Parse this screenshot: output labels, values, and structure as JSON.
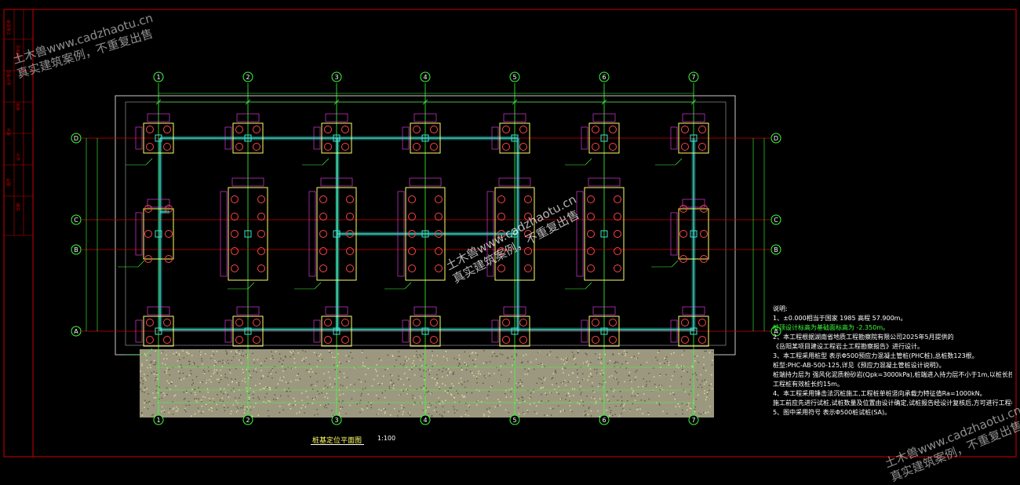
{
  "grid": {
    "columns": [
      "1",
      "2",
      "3",
      "4",
      "5",
      "6",
      "7"
    ],
    "rows": [
      "D",
      "C",
      "B",
      "A"
    ]
  },
  "plan": {
    "title": "桩基定位平面图",
    "scale": "1:100"
  },
  "notes": {
    "heading": "说明:",
    "lines": [
      "1、±0.000相当于国家 1985 高程 57.900m。",
      "桩顶设计标高为基础面标高为 -2.350m。",
      "2、本工程根据湖南省地质工程勘察院有限公司2025年5月提供的",
      "《岳阳某项目建设工程岩土工程勘察报告》进行设计。",
      "3、本工程采用桩型   表示Φ500预应力混凝土管桩(PHC桩),总桩数123根。",
      "桩型:PHC-AB-500-125,详见《预应力混凝土管桩设计说明》。",
      "桩端持力层为   强风化泥质粉砂岩(Qpk=3000kPa),桩端进入持力层不小于1m,以桩长控制为主。",
      "工程桩有效桩长约15m。",
      "4、本工程采用锤击法沉桩施工,工程桩单桩竖向承载力特征值Ra=1000kN。",
      "施工前应先进行试桩,试桩数量及位置由设计确定,试桩报告经设计复核后,方可进行工程桩施工。",
      "5、图中采用符号    表示Φ500桩试桩(SA)。"
    ]
  },
  "watermarks": [
    {
      "line1": "土木兽www.cadzhaotu.cn",
      "line2": "真实建筑案例，不重复出售"
    },
    {
      "line1": "土木兽www.cadzhaotu.cn",
      "line2": "真实建筑案例，不重复出售"
    },
    {
      "line1": "土木兽www.cadzhaotu.cn",
      "line2": "真实建筑案例，不重复出售"
    }
  ],
  "title_block": {
    "texts": [
      "工程名称",
      "建设单位",
      "设计单位",
      "审核",
      "校对",
      "设计",
      "图号",
      "日期"
    ]
  },
  "colors": {
    "background": "#000000",
    "border": "#cc0000",
    "axis_line": "#cc0000",
    "grid_bubble": "#3cff3c",
    "pile_cap": "#ffff66",
    "pile": "#ff4444",
    "dimension": "#ff44ff",
    "tie_beam": "#40e0d0",
    "hatch": "#e8e2a0",
    "text": "#ffffff"
  }
}
